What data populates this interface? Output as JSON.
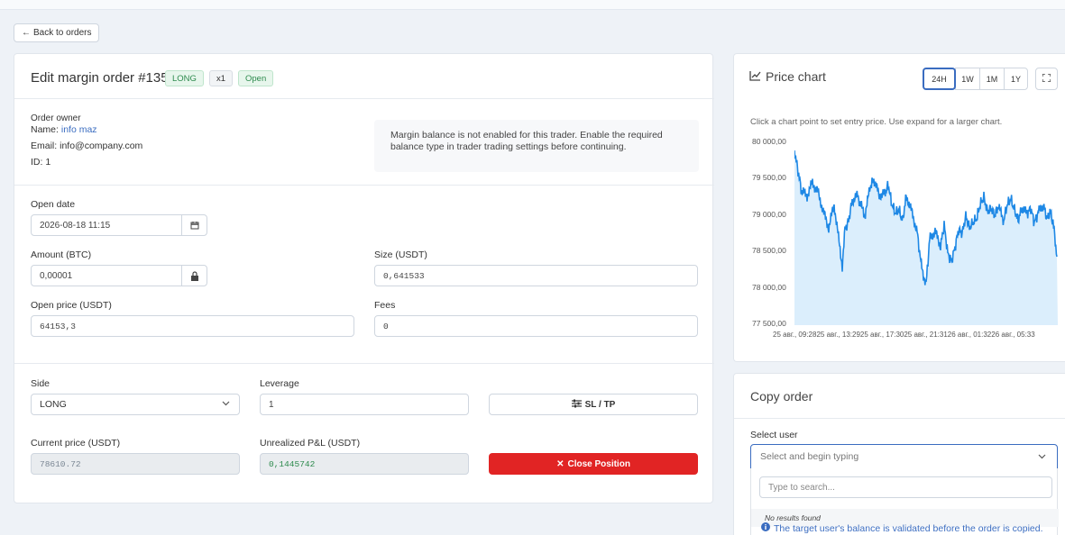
{
  "nav": {
    "back_label": "Back to orders"
  },
  "order": {
    "title": "Edit margin order #135",
    "badges": {
      "side": "LONG",
      "leverage": "x1",
      "status": "Open"
    },
    "owner": {
      "heading": "Order owner",
      "name_label": "Name:",
      "name_value": "info maz",
      "email_label": "Email:",
      "email_value": "info@company.com",
      "id_label": "ID:",
      "id_value": "1"
    },
    "notice": "Margin balance is not enabled for this trader. Enable the required balance type in trader trading settings before continuing.",
    "open_date": {
      "label": "Open date",
      "value": "2026-08-18 11:15"
    },
    "amount": {
      "label": "Amount (BTC)",
      "value": "0,00001"
    },
    "size": {
      "label": "Size (USDT)",
      "value": "0,641533"
    },
    "open_price": {
      "label": "Open price (USDT)",
      "value": "64153,3"
    },
    "fees": {
      "label": "Fees",
      "value": "0"
    },
    "side": {
      "label": "Side",
      "value": "LONG"
    },
    "leverage": {
      "label": "Leverage",
      "value": "1"
    },
    "sltp_label": "SL / TP",
    "current_price": {
      "label": "Current price (USDT)",
      "value": "78610.72"
    },
    "pnl": {
      "label": "Unrealized P&L (USDT)",
      "value": "0,1445742"
    },
    "close_label": "Close Position"
  },
  "price_chart": {
    "title": "Price chart",
    "ranges": [
      "24H",
      "1W",
      "1M",
      "1Y"
    ],
    "active_range": "24H",
    "hint": "Click a chart point to set entry price. Use expand for a larger chart.",
    "y_ticks": [
      "80 000,00",
      "79 500,00",
      "79 000,00",
      "78 500,00",
      "78 000,00",
      "77 500,00"
    ],
    "x_ticks": "25 авг., 09:2825 авг., 13:2925 авг., 17:3025 авг., 21:3126 авг., 01:3226 авг., 05:33",
    "line_color": "#1e88e5",
    "fill_color": "#dbeefc"
  },
  "copy_order": {
    "title": "Copy order",
    "select_label": "Select user",
    "select_placeholder": "Select and begin typing",
    "search_placeholder": "Type to search...",
    "no_results": "No results found",
    "info": "The target user's balance is validated before the order is copied."
  }
}
